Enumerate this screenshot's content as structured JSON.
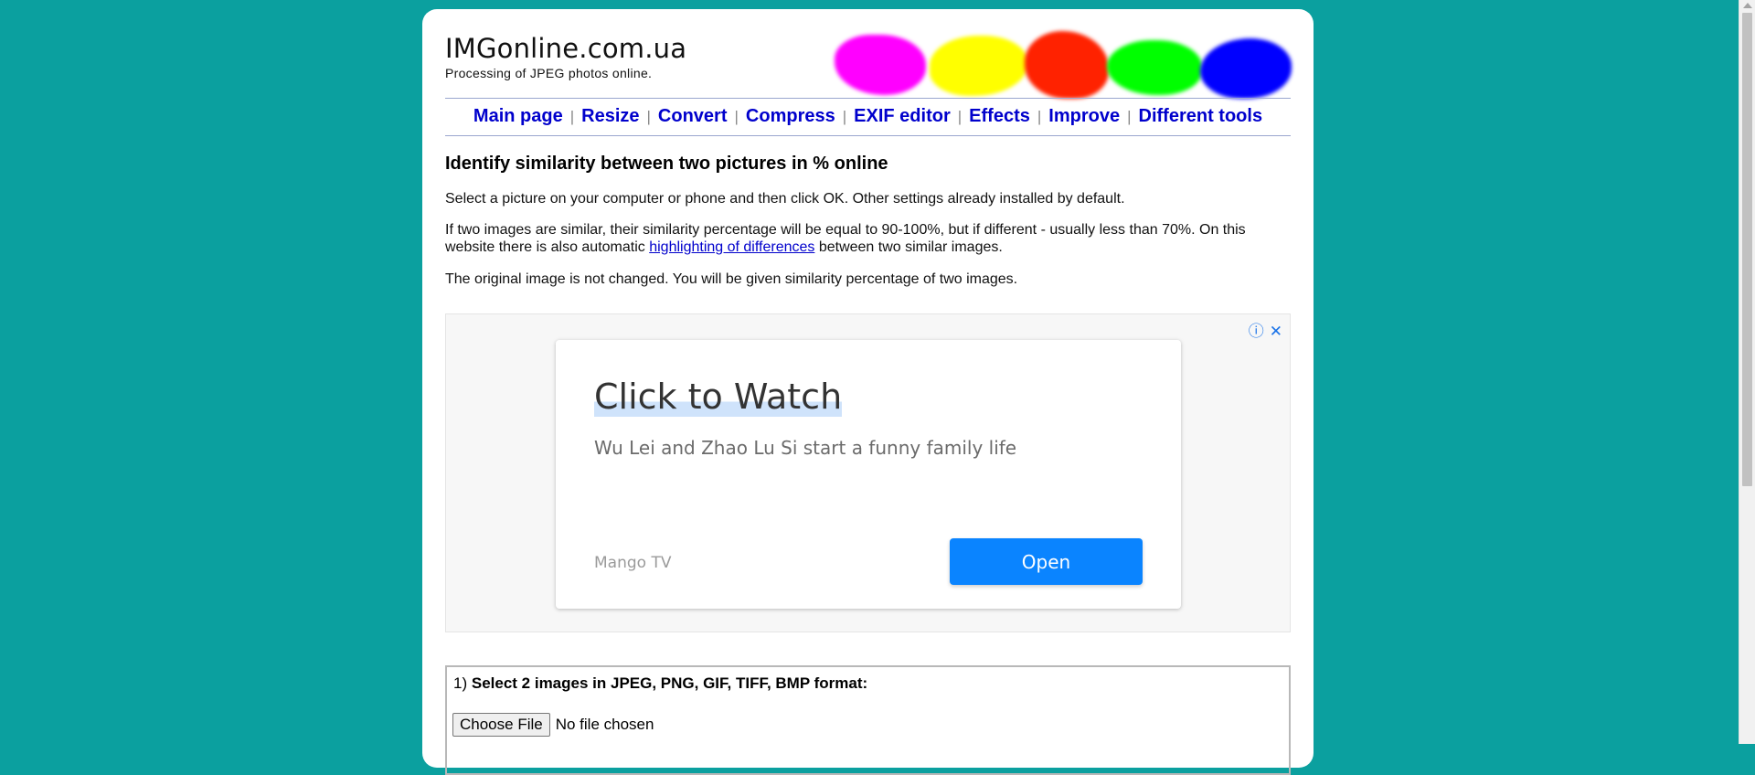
{
  "header": {
    "site_title": "IMGonline.com.ua",
    "tagline": "Processing of JPEG photos online.",
    "logo_colors": [
      "#ff00ff",
      "#ffff00",
      "#ff2200",
      "#00ff00",
      "#0000ff"
    ]
  },
  "nav": {
    "items": [
      {
        "label": "Main page"
      },
      {
        "label": "Resize"
      },
      {
        "label": "Convert"
      },
      {
        "label": "Compress"
      },
      {
        "label": "EXIF editor"
      },
      {
        "label": "Effects"
      },
      {
        "label": "Improve"
      },
      {
        "label": "Different tools"
      }
    ],
    "separator": "|"
  },
  "main": {
    "heading": "Identify similarity between two pictures in % online",
    "p1": "Select a picture on your computer or phone and then click OK. Other settings already installed by default.",
    "p2_before": "If two images are similar, their similarity percentage will be equal to 90-100%, but if different - usually less than 70%. On this website there is also automatic ",
    "p2_link": "highlighting of differences",
    "p2_after": " between two similar images.",
    "p3": "The original image is not changed. You will be given similarity percentage of two images."
  },
  "ad": {
    "info_icon": "ⓘ",
    "close_icon": "✕",
    "title": "Click to Watch",
    "subtitle": "Wu Lei and Zhao Lu Si start a funny family life",
    "brand": "Mango TV",
    "button_label": "Open",
    "button_color": "#0a84ff"
  },
  "form": {
    "step_number": "1)",
    "step_label": "Select 2 images in JPEG, PNG, GIF, TIFF, BMP format:",
    "choose_file_label": "Choose File",
    "no_file_text": "No file chosen"
  },
  "colors": {
    "background": "#0ba09f",
    "link": "#0000cc"
  }
}
